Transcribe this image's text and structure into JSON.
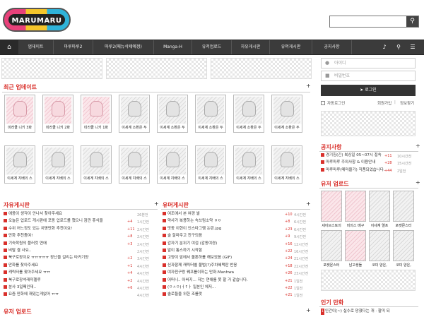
{
  "header": {
    "logo_text": "MARUMARU II",
    "search_placeholder": ""
  },
  "nav": {
    "items": [
      "업데이트",
      "마루마루2",
      "마루2(메뉴삭제예정)",
      "Manga-H",
      "유저업로드",
      "자유게시판",
      "유머게시판",
      "공지사항"
    ]
  },
  "recent": {
    "title": "최근 업데이트",
    "row1": [
      "미라클 니키 3화",
      "미라클 니키 2화",
      "미라클 니키 1화",
      "이세계 소환은 두",
      "이세계 소환은 두",
      "이세계 소환은 두",
      "이세계 소환은 두",
      "이세계 소환은 두"
    ],
    "row2": [
      "이세계 지배의 스",
      "이세계 지배의 스",
      "이세계 지배의 스",
      "이세계 지배의 스",
      "이세계 지배의 스",
      "이세계 지배의 스",
      "이세계 지배의 스",
      "이세계 지배의 스"
    ]
  },
  "free_board": {
    "title": "자유게시판",
    "rows": [
      {
        "text": "애옹이 생각이 안나서 찾아주세요",
        "count": "",
        "time": "26분전"
      },
      {
        "text": "오늘은 업로드 게시판에 포동 업로드를 했으니 잠깐 휴식을",
        "count": "+4",
        "time": "1시간전"
      },
      {
        "text": "수위 어느정도 있는 치명만화 추천이요!",
        "count": "+11",
        "time": "2시간전"
      },
      {
        "text": "만화 추천좀여!",
        "count": "+8",
        "time": "2시간전"
      },
      {
        "text": "기숙학원의 플러컷 연애",
        "count": "+3",
        "time": "2시간전"
      },
      {
        "text": "비탈 결 사요..",
        "count": "",
        "time": "2시간전"
      },
      {
        "text": "북구로장이요 ㅠㅠㅠㅠㅠ 장난을 걸리는 타카기양",
        "count": "+2",
        "time": "3시간전"
      },
      {
        "text": "만화를 찾아주세요",
        "count": "+1",
        "time": "4시간전"
      },
      {
        "text": "캐릭터를 찾아주세요 ㅠㅠ",
        "count": "+4",
        "time": "4시간전"
      },
      {
        "text": "북구로장석래미헬루",
        "count": "+2",
        "time": "4시간전"
      },
      {
        "text": "분사 3일째인데..",
        "count": "+6",
        "time": "4시간전"
      },
      {
        "text": "요즘 만화에 재밌는게없어 ㅠㅠ",
        "count": "",
        "time": "4시간전"
      }
    ]
  },
  "humor_board": {
    "title": "유머게시판",
    "rows": [
      {
        "text": "여조에서 본 여경 썰",
        "count": "+10",
        "time": "4시간전"
      },
      {
        "text": "약사가 복용하는 속쓰림소약 ㅇㅇ",
        "count": "+8",
        "time": "6시간전"
      },
      {
        "text": "맛동 이현이 인스타그램 논란.jpg",
        "count": "+23",
        "time": "6시간전"
      },
      {
        "text": "술 잘마주고 친구되음",
        "count": "+9",
        "time": "9시간전"
      },
      {
        "text": "갑자기 분위기 여검 (감동여경)",
        "count": "+16",
        "time": "12시간전"
      },
      {
        "text": "말이 통스하기 시작함",
        "count": "+22",
        "time": "16시간전"
      },
      {
        "text": "고양이 앞에서 올톤하를 해보았음 (GIF)",
        "count": "+24",
        "time": "21시간전"
      },
      {
        "text": "신과함께 캐릭터별 불법(?)주차혜택판 반응",
        "count": "+18",
        "time": "22시간전"
      },
      {
        "text": "여자친구랑 꿰프를이하는 만화.Manhwa",
        "count": "+26",
        "time": "23시간전"
      },
      {
        "text": "어머니.. 아버지... 저는 연애를 못 할 거 같습니다.",
        "count": "+21",
        "time": "1일전"
      },
      {
        "text": "(ㅇㅅㅇ)ㅓ↑ㅏ 일본인 체저...",
        "count": "+22",
        "time": "1일전"
      },
      {
        "text": "솔로들을 위한 조를랏",
        "count": "+21",
        "time": "1일전"
      }
    ]
  },
  "user_upload_bottom": {
    "title": "유저 업로드"
  },
  "login": {
    "id_placeholder": "아이디",
    "pw_placeholder": "비밀번호",
    "button": "로그인",
    "remember": "자동로그인",
    "register": "회원가입",
    "find": "정보찾기"
  },
  "notice": {
    "title": "공지사항",
    "rows": [
      {
        "text": "경기침(긴) 복싱일 05~07시 접속",
        "count": "+11",
        "time": "10시간전"
      },
      {
        "text": "마루마루 주의사항 & 이용안내",
        "count": "+28",
        "time": "15시간전"
      },
      {
        "text": "마루마루(메마을가) 직품되었습니다.",
        "count": "+44",
        "time": "2일전"
      }
    ]
  },
  "user_upload": {
    "title": "유저 업로드",
    "captions": [
      "세이브스토의",
      "미의스 메구",
      "이세계 엘프",
      "포켓몬스터",
      "포켓몬스터",
      "남고생들 ",
      "코미 양은,",
      "코미 양은,"
    ]
  },
  "popular": {
    "title": "인기 만화",
    "rows": [
      {
        "rank": "1",
        "text": "인간이(~) 실수로 망쳤다는 개 · 할미 되",
        "count": ""
      }
    ]
  }
}
